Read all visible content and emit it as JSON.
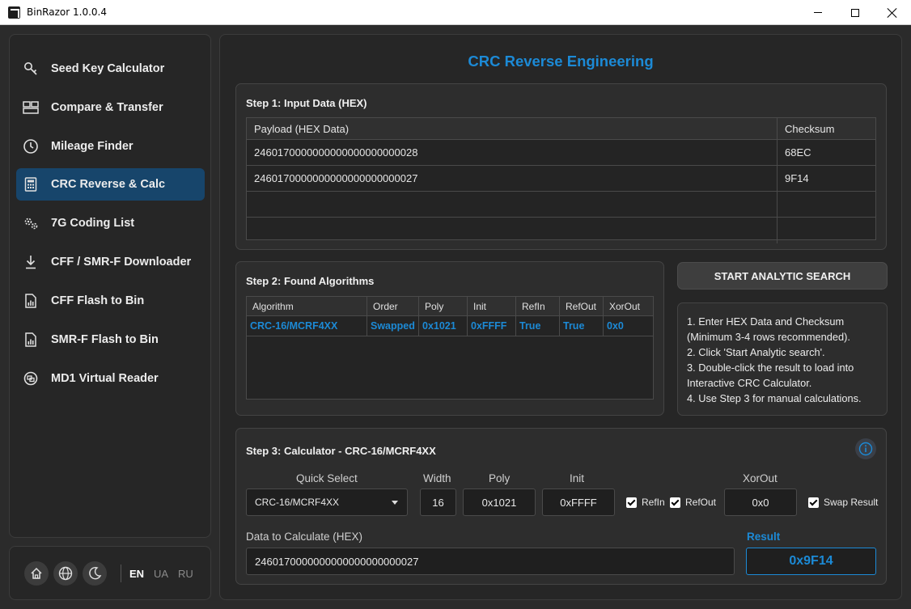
{
  "window": {
    "title": "BinRazor 1.0.0.4"
  },
  "sidebar": {
    "items": [
      {
        "label": "Seed Key Calculator",
        "icon": "key-icon"
      },
      {
        "label": "Compare & Transfer",
        "icon": "compare-icon"
      },
      {
        "label": "Mileage Finder",
        "icon": "clock-icon"
      },
      {
        "label": "CRC Reverse & Calc",
        "icon": "calculator-icon",
        "active": true
      },
      {
        "label": "7G Coding List",
        "icon": "gears-icon"
      },
      {
        "label": "CFF / SMR-F Downloader",
        "icon": "download-icon"
      },
      {
        "label": "CFF Flash to Bin",
        "icon": "file-chart-icon"
      },
      {
        "label": "SMR-F Flash to Bin",
        "icon": "file-chart-icon"
      },
      {
        "label": "MD1 Virtual Reader",
        "icon": "chip-icon"
      }
    ],
    "languages": [
      "EN",
      "UA",
      "RU"
    ],
    "active_language": "EN"
  },
  "main": {
    "title": "CRC Reverse Engineering",
    "step1": {
      "title": "Step 1: Input Data (HEX)",
      "columns": [
        "Payload (HEX Data)",
        "Checksum"
      ],
      "rows": [
        [
          "2460170000000000000000000028",
          "68EC"
        ],
        [
          "2460170000000000000000000027",
          "9F14"
        ],
        [
          "",
          ""
        ],
        [
          "",
          ""
        ]
      ]
    },
    "step2": {
      "title": "Step 2: Found Algorithms",
      "columns": [
        "Algorithm",
        "Order",
        "Poly",
        "Init",
        "RefIn",
        "RefOut",
        "XorOut"
      ],
      "rows": [
        [
          "CRC-16/MCRF4XX",
          "Swapped",
          "0x1021",
          "0xFFFF",
          "True",
          "True",
          "0x0"
        ]
      ]
    },
    "start_button": "START ANALYTIC SEARCH",
    "help": [
      "1. Enter HEX Data and Checksum",
      "(Minimum 3-4 rows recommended).",
      "2. Click 'Start Analytic search'.",
      "3. Double-click the result to load into",
      "Interactive CRC Calculator.",
      "4. Use Step 3 for manual calculations."
    ],
    "step3": {
      "title": "Step 3: Calculator - CRC-16/MCRF4XX",
      "quick_select_label": "Quick Select",
      "quick_select_value": "CRC-16/MCRF4XX",
      "width_label": "Width",
      "width_value": "16",
      "poly_label": "Poly",
      "poly_value": "0x1021",
      "init_label": "Init",
      "init_value": "0xFFFF",
      "refin_label": "RefIn",
      "refout_label": "RefOut",
      "xorout_label": "XorOut",
      "xorout_value": "0x0",
      "swap_label": "Swap Result",
      "data_label": "Data to Calculate (HEX)",
      "data_value": "2460170000000000000000000027",
      "result_label": "Result",
      "result_value": "0x9F14"
    }
  },
  "colors": {
    "accent": "#1c8ad6",
    "active_nav": "#17456b",
    "background": "#2b2b2b"
  }
}
